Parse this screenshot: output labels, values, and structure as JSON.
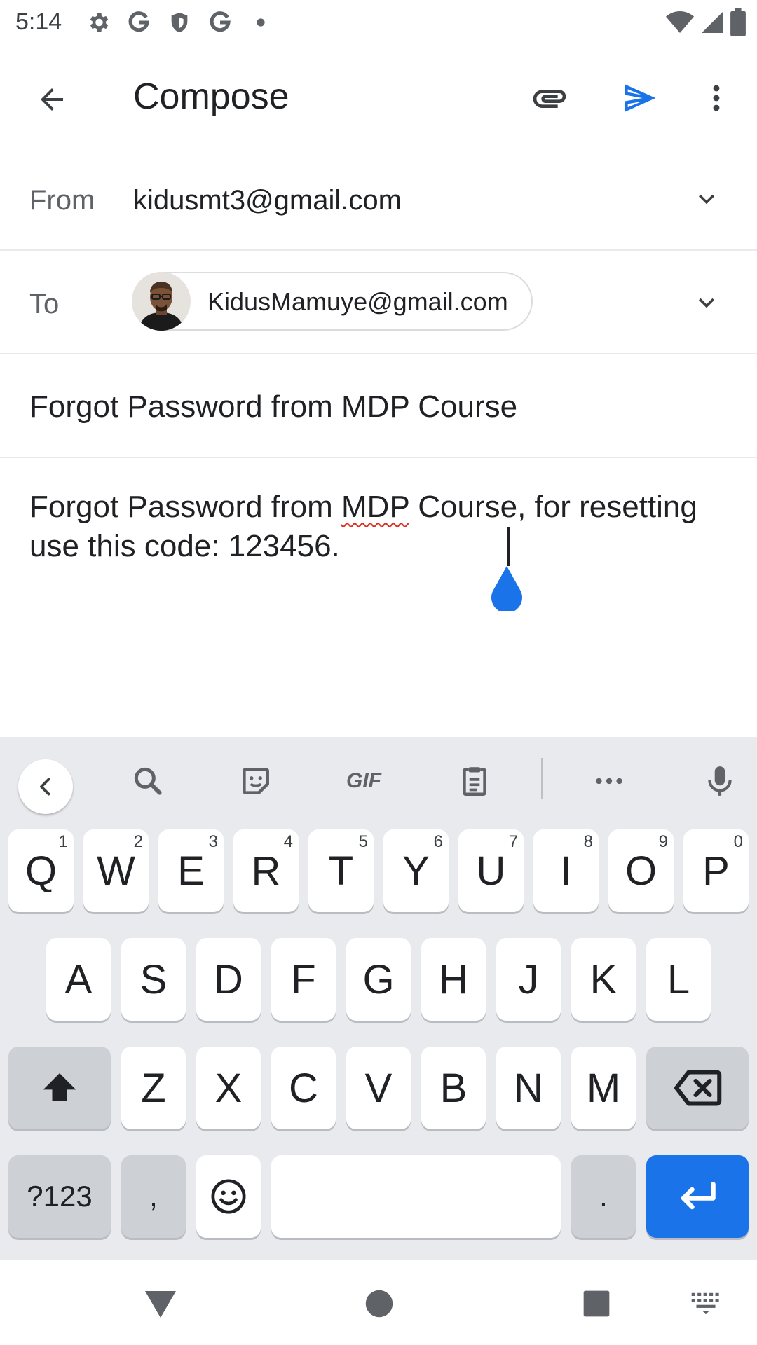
{
  "status_bar": {
    "time": "5:14",
    "left_icons": [
      "settings-icon",
      "google-icon",
      "shield-icon",
      "google-icon",
      "dot-icon"
    ],
    "right_icons": [
      "wifi-icon",
      "signal-icon",
      "battery-icon"
    ]
  },
  "app_bar": {
    "title": "Compose",
    "icons": [
      "back-arrow-icon",
      "paperclip-icon",
      "send-icon",
      "more-vert-icon"
    ],
    "send_color": "#1a73e8"
  },
  "from": {
    "label": "From",
    "value": "kidusmt3@gmail.com"
  },
  "to": {
    "label": "To",
    "chip_email": "KidusMamuye@gmail.com"
  },
  "subject": {
    "value": "Forgot Password from MDP Course"
  },
  "body": {
    "before_misspelled": "Forgot Password from ",
    "misspelled": "MDP",
    "after_misspelled": " Course, for resetting use this code: 123456."
  },
  "keyboard": {
    "toolbar_icons": [
      "collapse-icon",
      "search-icon",
      "sticker-icon",
      "gif-icon",
      "clipboard-icon",
      "more-horiz-icon",
      "mic-icon"
    ],
    "gif_label": "GIF",
    "row1": [
      {
        "key": "Q",
        "hint": "1"
      },
      {
        "key": "W",
        "hint": "2"
      },
      {
        "key": "E",
        "hint": "3"
      },
      {
        "key": "R",
        "hint": "4"
      },
      {
        "key": "T",
        "hint": "5"
      },
      {
        "key": "Y",
        "hint": "6"
      },
      {
        "key": "U",
        "hint": "7"
      },
      {
        "key": "I",
        "hint": "8"
      },
      {
        "key": "O",
        "hint": "9"
      },
      {
        "key": "P",
        "hint": "0"
      }
    ],
    "row2": [
      "A",
      "S",
      "D",
      "F",
      "G",
      "H",
      "J",
      "K",
      "L"
    ],
    "row3": [
      "Z",
      "X",
      "C",
      "V",
      "B",
      "N",
      "M"
    ],
    "bottom": {
      "symbols": "?123",
      "comma": ",",
      "period": "."
    },
    "enter_color": "#1a73e8"
  },
  "nav_bar": {
    "icons": [
      "back-triangle-icon",
      "home-circle-icon",
      "recents-square-icon",
      "keyboard-switch-icon"
    ]
  }
}
